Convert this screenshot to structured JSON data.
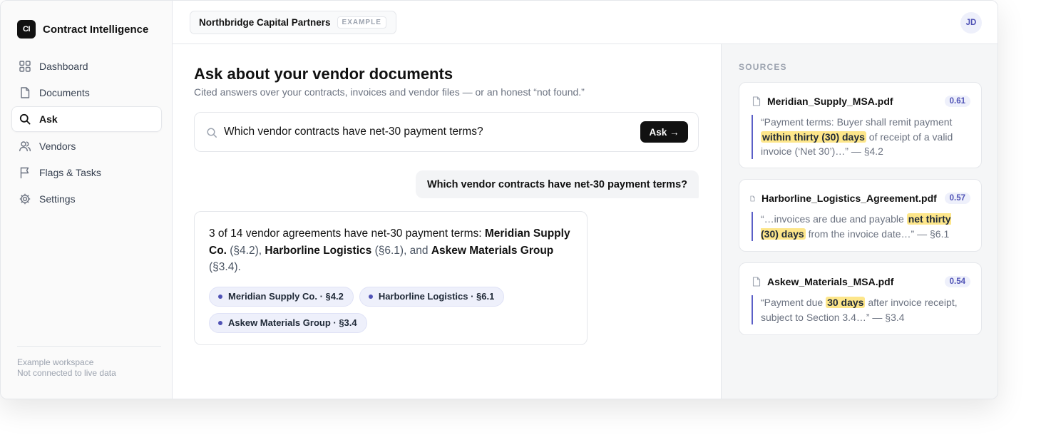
{
  "app": {
    "brand_mark": "CI",
    "brand_name": "Contract Intelligence"
  },
  "sidebar": {
    "items": [
      {
        "label": "Dashboard",
        "icon": "grid-icon"
      },
      {
        "label": "Documents",
        "icon": "document-icon"
      },
      {
        "label": "Ask",
        "icon": "search-icon",
        "active": true
      },
      {
        "label": "Vendors",
        "icon": "users-icon"
      },
      {
        "label": "Flags & Tasks",
        "icon": "flag-icon"
      },
      {
        "label": "Settings",
        "icon": "gear-icon"
      }
    ],
    "footer_line1": "Example workspace",
    "footer_line2": "Not connected to live data"
  },
  "header": {
    "workspace_name": "Northbridge Capital Partners",
    "workspace_tag": "EXAMPLE",
    "avatar_initials": "JD"
  },
  "main": {
    "title": "Ask about your vendor documents",
    "subtitle": "Cited answers over your contracts, invoices and vendor files — or an honest “not found.”",
    "search_value": "Which vendor contracts have net-30 payment terms?",
    "ask_button": "Ask →",
    "user_question": "Which vendor contracts have net-30 payment terms?",
    "answer": {
      "intro": "3 of 14 vendor agreements have net-30 payment terms: ",
      "vendor1": "Meridian Supply Co.",
      "sec1": " (§4.2), ",
      "vendor2": "Harborline Logistics",
      "sec2": " (§6.1), and ",
      "vendor3": "Askew Materials Group",
      "sec3": " (§3.4)."
    },
    "citations": [
      "Meridian Supply Co. · §4.2",
      "Harborline Logistics · §6.1",
      "Askew Materials Group · §3.4"
    ]
  },
  "sources": {
    "label": "SOURCES",
    "items": [
      {
        "file": "Meridian_Supply_MSA.pdf",
        "score": "0.61",
        "before": "“Payment terms: Buyer shall remit payment ",
        "highlight": "within thirty (30) days",
        "after": " of receipt of a valid invoice (‘Net 30’)…” — §4.2"
      },
      {
        "file": "Harborline_Logistics_Agreement.pdf",
        "score": "0.57",
        "before": "“…invoices are due and payable ",
        "highlight": "net thirty (30) days",
        "after": " from the invoice date…” — §6.1"
      },
      {
        "file": "Askew_Materials_MSA.pdf",
        "score": "0.54",
        "before": "“Payment due ",
        "highlight": "30 days",
        "after": " after invoice receipt, subject to Section 3.4…” — §3.4"
      }
    ]
  },
  "colors": {
    "accent": "#4f52b5",
    "highlight": "#fde68a",
    "dark": "#111111"
  }
}
